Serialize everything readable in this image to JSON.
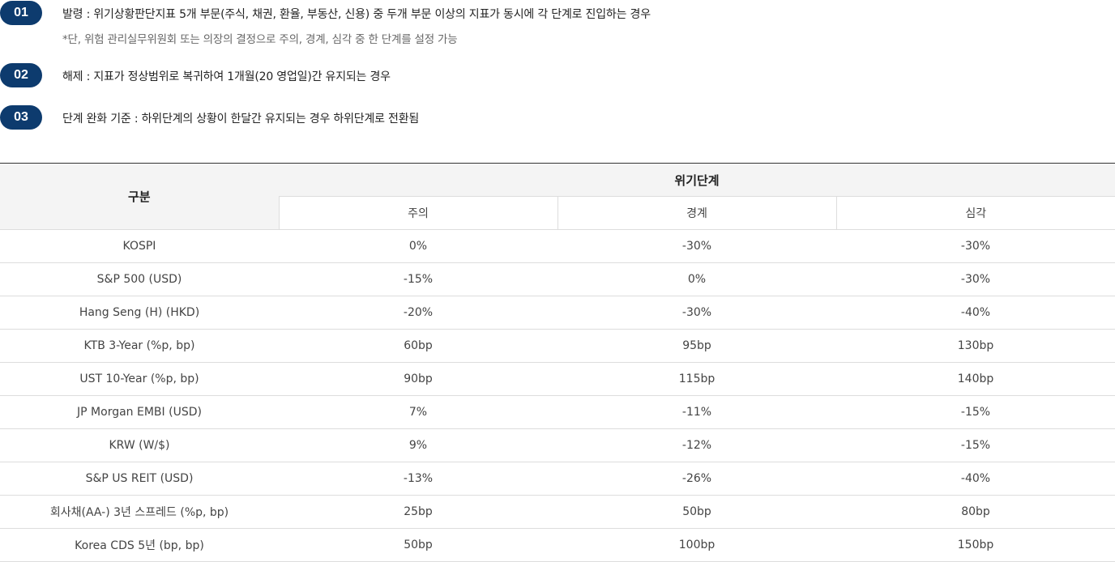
{
  "steps": [
    {
      "badge": "01",
      "text": "발령 : 위기상황판단지표 5개 부문(주식, 채권, 환율, 부동산, 신용) 중 두개 부문 이상의 지표가 동시에 각 단계로 진입하는 경우",
      "note": "*단, 위험 관리실무위원회 또는 의장의 결정으로 주의, 경계, 심각 중 한 단계를 설정 가능"
    },
    {
      "badge": "02",
      "text": "해제 : 지표가 정상범위로 복귀하여 1개월(20 영업일)간 유지되는 경우"
    },
    {
      "badge": "03",
      "text": "단계 완화 기준 : 하위단계의 상황이 한달간 유지되는 경우 하위단계로 전환됨"
    }
  ],
  "table": {
    "label_header": "구분",
    "group_header": "위기단계",
    "levels": [
      "주의",
      "경계",
      "심각"
    ],
    "rows": [
      {
        "name": "KOSPI",
        "values": [
          "0%",
          "-30%",
          "-30%"
        ]
      },
      {
        "name": "S&P 500 (USD)",
        "values": [
          "-15%",
          "0%",
          "-30%"
        ]
      },
      {
        "name": "Hang Seng (H) (HKD)",
        "values": [
          "-20%",
          "-30%",
          "-40%"
        ]
      },
      {
        "name": "KTB 3-Year (%p, bp)",
        "values": [
          "60bp",
          "95bp",
          "130bp"
        ]
      },
      {
        "name": "UST 10-Year (%p, bp)",
        "values": [
          "90bp",
          "115bp",
          "140bp"
        ]
      },
      {
        "name": "JP Morgan EMBI (USD)",
        "values": [
          "7%",
          "-11%",
          "-15%"
        ]
      },
      {
        "name": "KRW (W/$)",
        "values": [
          "9%",
          "-12%",
          "-15%"
        ]
      },
      {
        "name": "S&P US REIT (USD)",
        "values": [
          "-13%",
          "-26%",
          "-40%"
        ]
      },
      {
        "name": "회사채(AA-) 3년 스프레드 (%p, bp)",
        "values": [
          "25bp",
          "50bp",
          "80bp"
        ]
      },
      {
        "name": "Korea CDS 5년 (bp, bp)",
        "values": [
          "50bp",
          "100bp",
          "150bp"
        ]
      }
    ]
  },
  "colors": {
    "badge": "#0d3b6e",
    "header_bg": "#f4f4f4",
    "top_border": "#333333",
    "row_border": "#dddddd"
  }
}
